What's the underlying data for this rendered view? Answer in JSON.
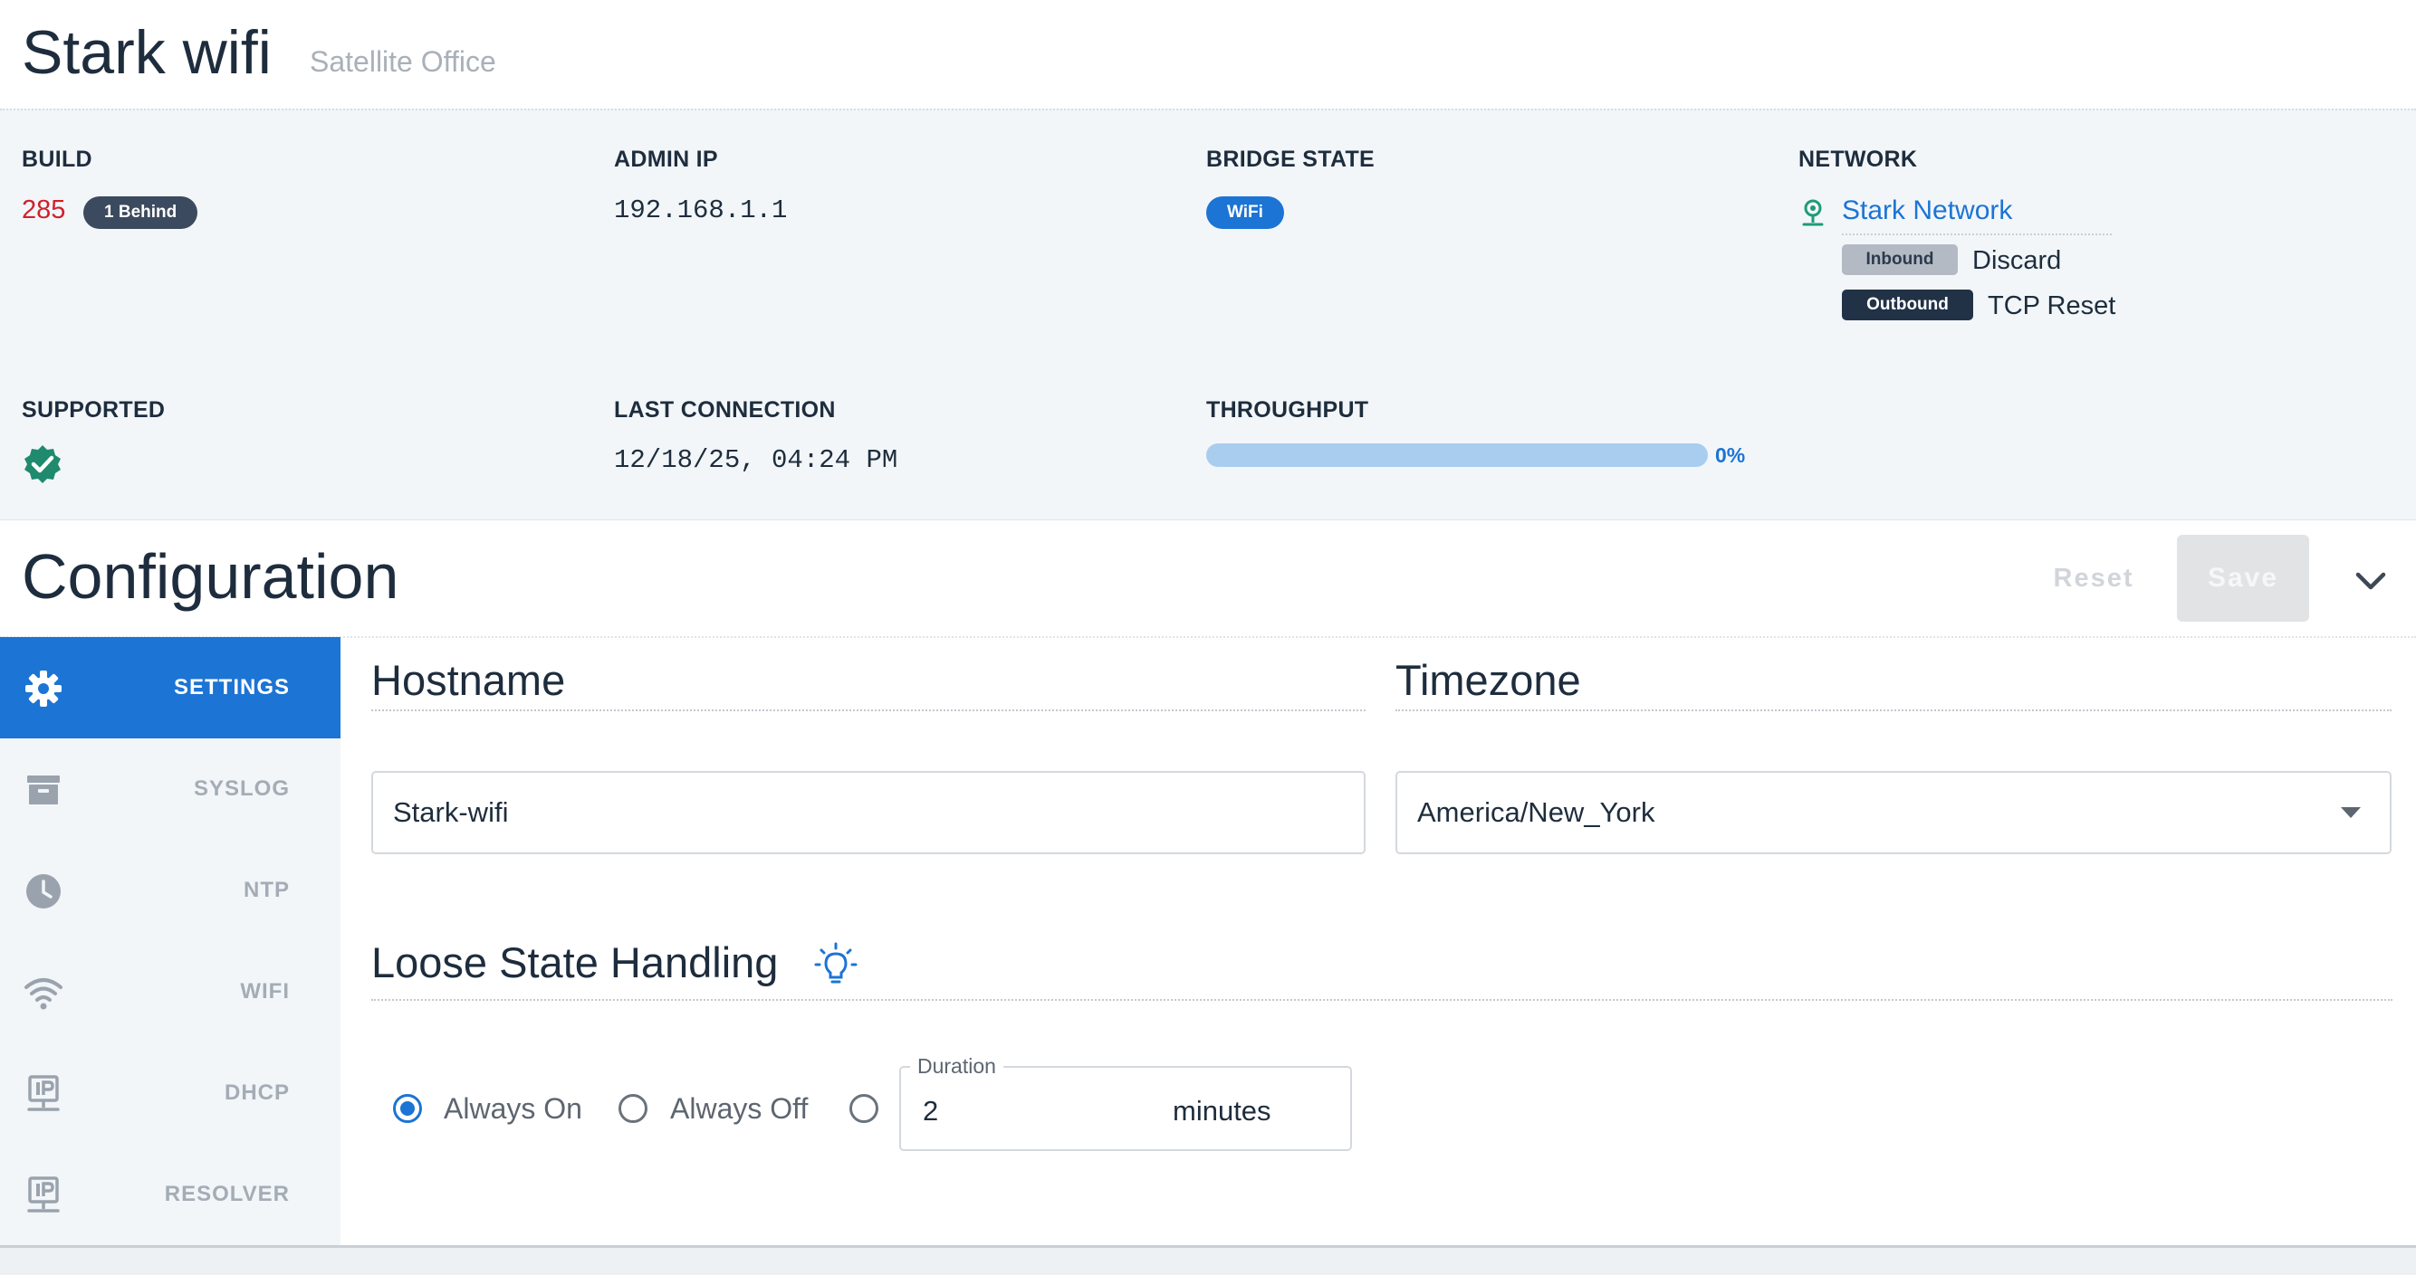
{
  "device": {
    "name": "Stark wifi",
    "location": "Satellite Office"
  },
  "info": {
    "build": {
      "label": "BUILD",
      "value": "285",
      "badge": "1 Behind"
    },
    "admin_ip": {
      "label": "ADMIN IP",
      "value": "192.168.1.1"
    },
    "bridge_state": {
      "label": "BRIDGE STATE",
      "value": "WiFi"
    },
    "network": {
      "label": "NETWORK",
      "name": "Stark Network",
      "icon": "location-pin-icon",
      "rules": [
        {
          "tag": "Inbound",
          "action": "Discard"
        },
        {
          "tag": "Outbound",
          "action": "TCP Reset"
        }
      ]
    },
    "supported": {
      "label": "SUPPORTED",
      "icon": "verified-badge-icon",
      "value": true
    },
    "last_connection": {
      "label": "LAST CONNECTION",
      "value": "12/18/25, 04:24 PM"
    },
    "throughput": {
      "label": "THROUGHPUT",
      "percent": 0,
      "text": "0%"
    }
  },
  "configuration": {
    "title": "Configuration",
    "reset_label": "Reset",
    "save_label": "Save",
    "sidebar": [
      {
        "label": "SETTINGS",
        "icon": "gear-icon",
        "active": true
      },
      {
        "label": "SYSLOG",
        "icon": "archive-box-icon",
        "active": false
      },
      {
        "label": "NTP",
        "icon": "clock-icon",
        "active": false
      },
      {
        "label": "WIFI",
        "icon": "wifi-icon",
        "active": false
      },
      {
        "label": "DHCP",
        "icon": "ip-address-icon",
        "active": false
      },
      {
        "label": "RESOLVER",
        "icon": "ip-address-icon",
        "active": false
      }
    ],
    "hostname": {
      "title": "Hostname",
      "value": "Stark-wifi"
    },
    "timezone": {
      "title": "Timezone",
      "value": "America/New_York"
    },
    "loose_state": {
      "title": "Loose State Handling",
      "icon": "lightbulb-icon",
      "options": [
        {
          "label": "Always On",
          "checked": true
        },
        {
          "label": "Always Off",
          "checked": false
        },
        {
          "label": "",
          "checked": false
        }
      ],
      "duration": {
        "label": "Duration",
        "value": "2",
        "unit": "minutes"
      }
    }
  },
  "colors": {
    "accent": "#1c74d4",
    "build_number": "#d0202b",
    "panel": "#f2f6f9",
    "dark_tag": "#213247"
  }
}
